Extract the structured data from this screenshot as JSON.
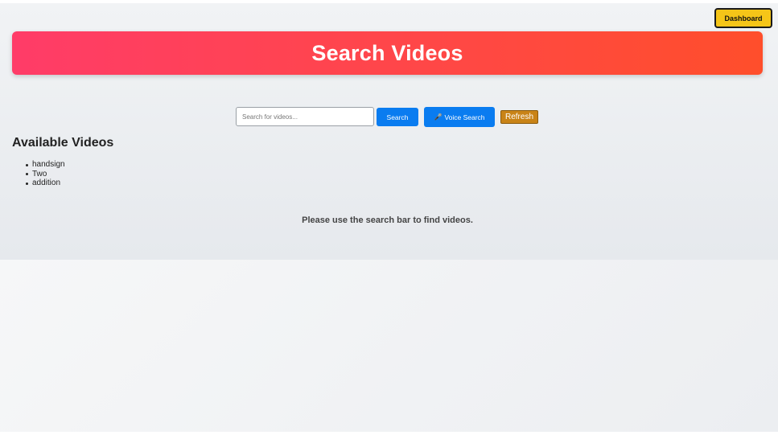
{
  "header": {
    "dashboard_label": "Dashboard",
    "title": "Search Videos"
  },
  "search": {
    "placeholder": "Search for videos...",
    "value": "",
    "search_label": "Search",
    "voice_icon": "microphone-icon",
    "voice_glyph": "🎤",
    "voice_label": "Voice Search",
    "refresh_label": "Refresh"
  },
  "videos": {
    "heading": "Available Videos",
    "items": [
      "handsign",
      "Two",
      "addition"
    ]
  },
  "hint": "Please use the search bar to find videos.",
  "colors": {
    "banner_start": "#ff3c68",
    "banner_end": "#ff4e2b",
    "primary_button": "#0a7cf0",
    "refresh_button": "#c98317",
    "dashboard_button": "#f5c518"
  }
}
